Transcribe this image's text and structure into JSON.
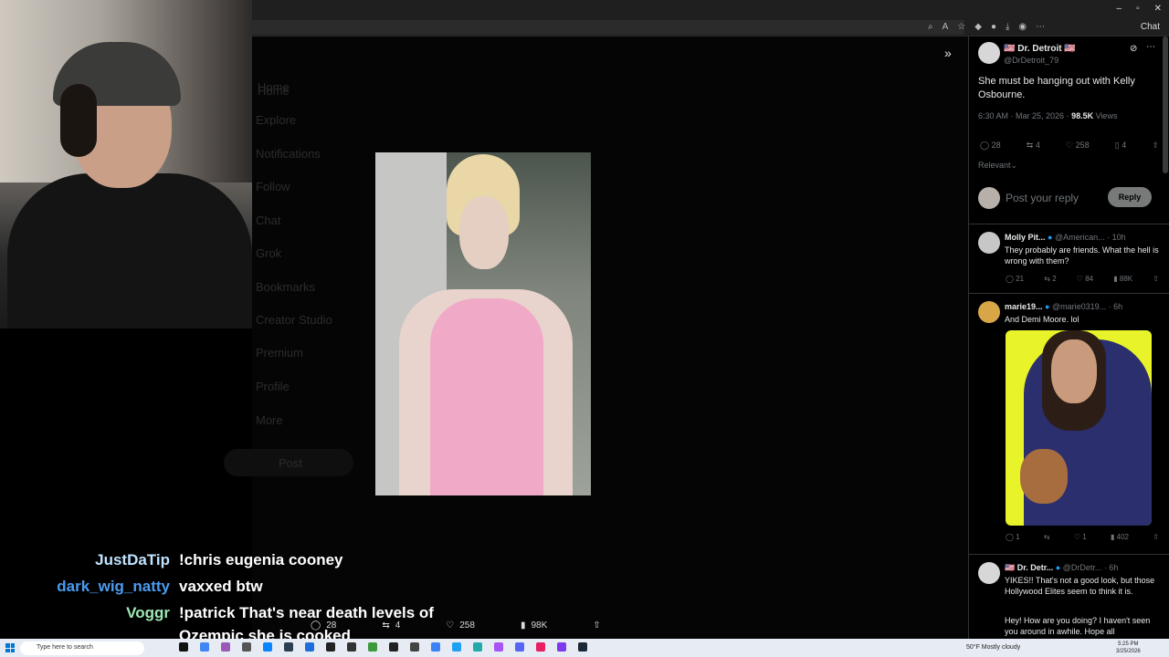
{
  "browser": {
    "extension_label": "Chat",
    "window_controls": [
      "–",
      "▫",
      "✕"
    ]
  },
  "background_nav": [
    "Home",
    "Explore",
    "Notifications",
    "Follow",
    "Chat",
    "Grok",
    "Bookmarks",
    "Creator Studio",
    "Premium",
    "Profile",
    "More"
  ],
  "background_post_label": "Post",
  "media_viewer": {
    "actions": {
      "replies": "28",
      "reposts": "4",
      "likes": "258",
      "views": "98K"
    }
  },
  "chat": [
    {
      "user": "JustDaTip",
      "color": "#bfe3ff",
      "message": "!chris eugenia cooney"
    },
    {
      "user": "dark_wig_natty",
      "color": "#4a9cf0",
      "message": "vaxxed btw"
    },
    {
      "user": "Voggr",
      "color": "#9ee8b4",
      "message": "!patrick That's near death levels of"
    }
  ],
  "chat_continuation": "Ozempic she is cooked",
  "tweet": {
    "display_name": "🇺🇸 Dr. Detroit 🇺🇸",
    "handle": "@DrDetroit_79",
    "text": "She must be hanging out with Kelly Osbourne.",
    "time": "6:30 AM · Mar 25, 2026 · ",
    "views_count": "98.5K",
    "views_label": " Views",
    "replies": "28",
    "reposts": "4",
    "likes": "258",
    "bookmarks": "4",
    "sort_label": "Relevant",
    "reply_placeholder": "Post your reply",
    "reply_button": "Reply"
  },
  "replies": [
    {
      "name": "Molly Pit...",
      "handle": "@American... · 10h",
      "text": "They probably are friends. What the hell is wrong with them?",
      "replies": "21",
      "reposts": "2",
      "likes": "84",
      "views": "88K"
    },
    {
      "name": "marie19...",
      "handle": "@marie0319... · 6h",
      "text": "And Demi Moore. lol",
      "replies": "1",
      "reposts": "",
      "likes": "1",
      "views": "402"
    },
    {
      "name": "🇺🇸 Dr. Detr...",
      "handle": "@DrDetr... · 6h",
      "text": "YIKES!! That's not a good look, but those Hollywood Elites seem to think it is.",
      "text2": "Hey! How are you doing? I haven't seen you around in awhile. Hope all"
    }
  ],
  "taskbar": {
    "search_placeholder": "Type here to search",
    "weather": "50°F  Mostly cloudy",
    "time": "5:25 PM",
    "date": "3/25/2026"
  },
  "colors": {
    "verified": "#1d9bf0",
    "panel_bg": "#000000",
    "muted": "#71767b"
  }
}
